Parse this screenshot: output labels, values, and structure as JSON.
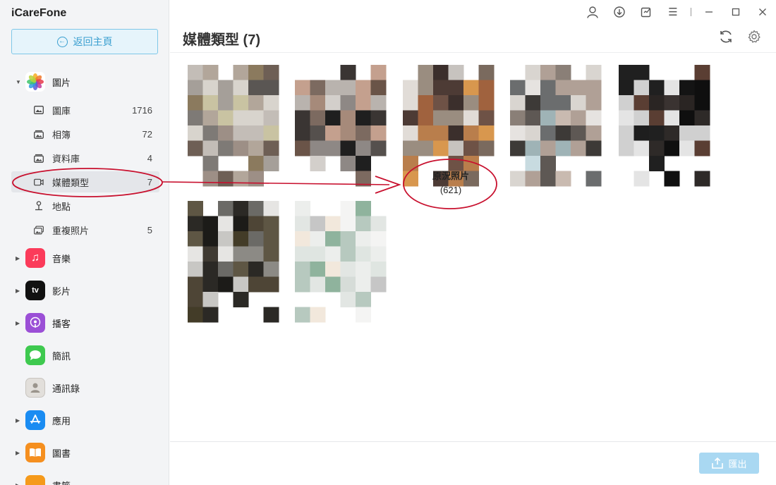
{
  "app": {
    "title": "iCareFone"
  },
  "sidebar": {
    "back_label": "返回主頁",
    "photos": {
      "label": "圖片",
      "items": [
        {
          "label": "圖庫",
          "count": "1716",
          "icon": "photo-library-icon"
        },
        {
          "label": "相簿",
          "count": "72",
          "icon": "album-icon"
        },
        {
          "label": "資料庫",
          "count": "4",
          "icon": "database-icon"
        },
        {
          "label": "媒體類型",
          "count": "7",
          "icon": "video-icon"
        },
        {
          "label": "地點",
          "count": "",
          "icon": "location-pin-icon"
        },
        {
          "label": "重複照片",
          "count": "5",
          "icon": "duplicate-icon"
        }
      ]
    },
    "categories": [
      {
        "label": "音樂",
        "icon": "music-icon",
        "color": "#fb3b5a",
        "expandable": true
      },
      {
        "label": "影片",
        "icon": "apple-tv-icon",
        "color": "#111111",
        "expandable": true
      },
      {
        "label": "播客",
        "icon": "podcast-icon",
        "color": "#9b4fd6",
        "expandable": true
      },
      {
        "label": "簡訊",
        "icon": "messages-icon",
        "color": "#3ec94f",
        "expandable": false
      },
      {
        "label": "通訊錄",
        "icon": "contacts-icon",
        "color": "#c9c9c9",
        "expandable": false
      },
      {
        "label": "應用",
        "icon": "app-store-icon",
        "color": "#1a8cf2",
        "expandable": true
      },
      {
        "label": "圖書",
        "icon": "books-icon",
        "color": "#f58f1f",
        "expandable": true
      },
      {
        "label": "書籤",
        "icon": "bookmark-icon",
        "color": "#f59a1b",
        "expandable": true
      }
    ]
  },
  "header": {
    "title": "媒體類型 (7)"
  },
  "toolbar": {
    "export_label": "匯出"
  },
  "annotation": {
    "title": "原況照片",
    "count": "(621)"
  },
  "colors": {
    "accent": "#3a9fd0",
    "annotation": "#c8102e"
  }
}
